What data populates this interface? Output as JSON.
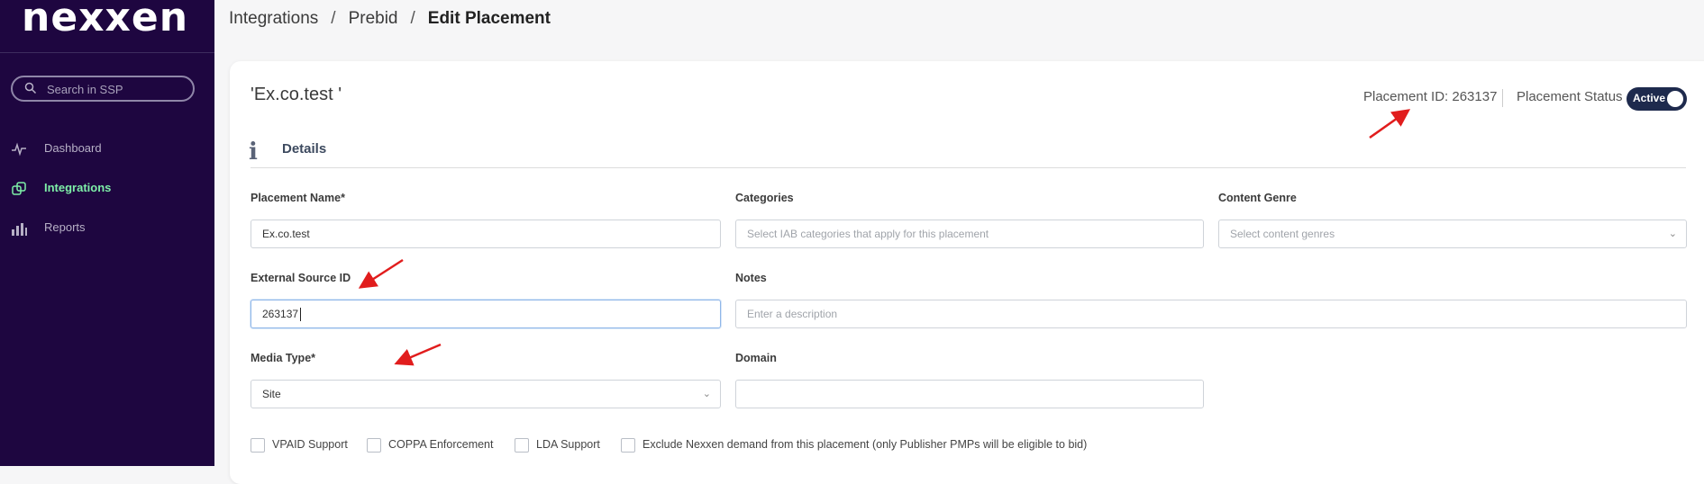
{
  "brand": {
    "logo_text": "nexxen",
    "sidebar_bg": "#1e0640",
    "accent": "#7ef0a8"
  },
  "sidebar": {
    "search_placeholder": "Search in SSP",
    "items": [
      {
        "label": "Dashboard",
        "icon": "activity-icon",
        "active": false
      },
      {
        "label": "Integrations",
        "icon": "integrations-icon",
        "active": true
      },
      {
        "label": "Reports",
        "icon": "bar-chart-icon",
        "active": false
      }
    ]
  },
  "breadcrumb": {
    "items": [
      "Integrations",
      "Prebid"
    ],
    "separator": "/",
    "current": "Edit Placement"
  },
  "placement": {
    "title": "'Ex.co.test '",
    "id_text": "Placement ID: 263137",
    "status_label": "Placement Status",
    "status_toggle": "Active"
  },
  "details": {
    "title": "Details",
    "placement_name": {
      "label": "Placement Name",
      "required": "*",
      "value": "Ex.co.test"
    },
    "categories": {
      "label": "Categories",
      "placeholder": "Select IAB categories that apply for this placement"
    },
    "content_genre": {
      "label": "Content Genre",
      "placeholder": "Select content genres"
    },
    "external_source_id": {
      "label": "External Source ID",
      "value": "263137"
    },
    "notes": {
      "label": "Notes",
      "placeholder": "Enter a description"
    },
    "media_type": {
      "label": "Media Type",
      "required": "*",
      "value": "Site"
    },
    "domain": {
      "label": "Domain",
      "value": ""
    }
  },
  "checkboxes": [
    {
      "label": "VPAID Support",
      "checked": false
    },
    {
      "label": "COPPA Enforcement",
      "checked": false
    },
    {
      "label": "LDA Support",
      "checked": false
    },
    {
      "label": "Exclude Nexxen demand from this placement (only Publisher PMPs will be eligible to bid)",
      "checked": false
    }
  ],
  "annotation_color": "#e11d1d"
}
